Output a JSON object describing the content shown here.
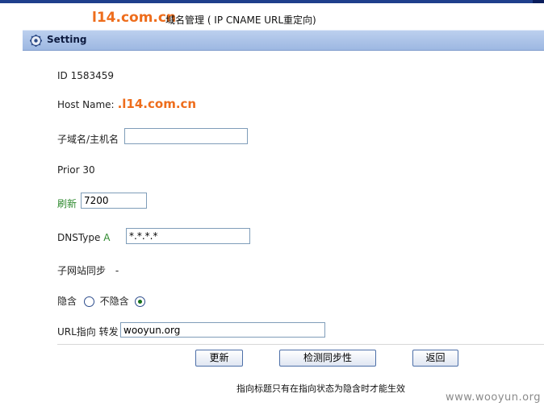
{
  "header": {
    "brand": "l14.com.cn",
    "subtitle": "域名管理 ( IP CNAME URL重定向)"
  },
  "panel": {
    "title": "Setting",
    "icon": "gear-icon"
  },
  "form": {
    "id_label": "ID",
    "id_value": "1583459",
    "host_label": "Host Name:",
    "host_value": ".l14.com.cn",
    "subdomain_label": "子域名/主机名",
    "subdomain_value": "",
    "prior_label": "Prior",
    "prior_value": "30",
    "refresh_label": "刷新",
    "refresh_value": "7200",
    "dnstype_label": "DNSType",
    "dnstype_value": "A",
    "dns_address_value": "*.*.*.*",
    "sync_label": "子网站同步",
    "sync_value": "-",
    "hide_label": "隐含",
    "nohide_label": "不隐含",
    "hide_selected": "不隐含",
    "url_label": "URL指向",
    "forward_label": "转发",
    "url_value": "wooyun.org"
  },
  "buttons": {
    "update": "更新",
    "check_sync": "检测同步性",
    "back": "返回"
  },
  "note": "指向标题只有在指向状态为隐含时才能生效",
  "watermark": "www.wooyun.org",
  "colors": {
    "brand": "#ee6d1c",
    "accent_green": "#2f8a2f",
    "panel_bar": "#9db8e2"
  }
}
